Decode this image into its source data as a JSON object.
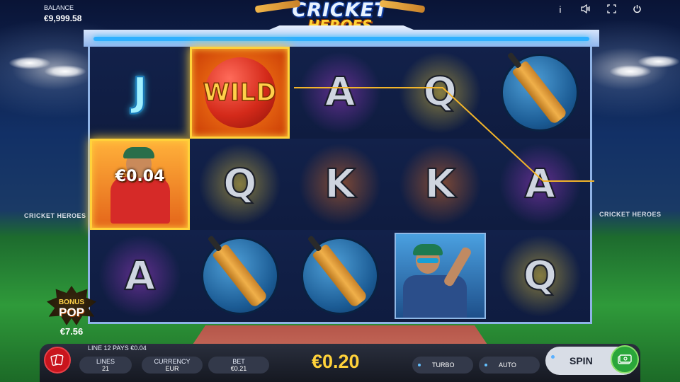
{
  "header": {
    "balance_label": "BALANCE",
    "balance_value": "€9,999.58",
    "icons": [
      "info-icon",
      "sound-icon",
      "fullscreen-icon",
      "power-icon"
    ]
  },
  "logo": {
    "line1": "CRICKET",
    "line2": "HEROES"
  },
  "stadium": {
    "sign_left": "CRICKET HEROES",
    "sign_right": "CRICKET HEROES"
  },
  "reels": {
    "symbols": [
      [
        "partial",
        "WILD",
        "A",
        "Q",
        "bat"
      ],
      [
        "player-red",
        "Q",
        "K",
        "K",
        "A"
      ],
      [
        "A",
        "bat",
        "bat",
        "player-blue",
        "Q"
      ]
    ],
    "wild_label": "WILD",
    "letters": {
      "r0c2": "A",
      "r0c3": "Q",
      "r1c1": "Q",
      "r1c2": "K",
      "r1c3": "K",
      "r1c4": "A",
      "r2c0": "A",
      "r2c4": "Q",
      "r0c0": "J"
    },
    "win_prize": "€0.04",
    "payline_color": "#f2b42a"
  },
  "bonus": {
    "line1": "BONUS",
    "line2": "POP",
    "amount": "€7.56"
  },
  "bottom": {
    "win_message": "LINE 12 PAYS €0.04",
    "lines_label": "LINES",
    "lines_value": "21",
    "currency_label": "CURRENCY",
    "currency_value": "EUR",
    "bet_label": "BET",
    "bet_value": "€0.21",
    "bet_amount": "€0.20",
    "turbo_label": "TURBO",
    "auto_label": "AUTO",
    "spin_label": "SPIN"
  }
}
